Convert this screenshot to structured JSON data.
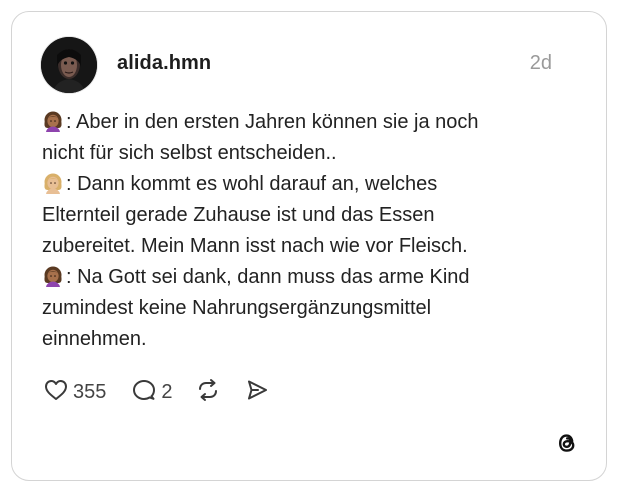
{
  "post": {
    "username": "alida.hmn",
    "timestamp": "2d",
    "lines": [
      {
        "speaker": "woman-brown",
        "text": ": Aber in den ersten Jahren können sie ja noch"
      },
      {
        "speaker": "",
        "text": "nicht für sich selbst entscheiden.."
      },
      {
        "speaker": "woman-blonde",
        "text": ": Dann kommt es wohl darauf an, welches"
      },
      {
        "speaker": "",
        "text": "Elternteil gerade Zuhause ist und das Essen"
      },
      {
        "speaker": "",
        "text": "zubereitet. Mein Mann isst nach wie vor Fleisch."
      },
      {
        "speaker": "woman-brown",
        "text": ": Na Gott sei dank, dann muss das arme Kind"
      },
      {
        "speaker": "",
        "text": "zumindest keine Nahrungsergänzungsmittel"
      },
      {
        "speaker": "",
        "text": "einnehmen."
      }
    ]
  },
  "actions": {
    "likes": "355",
    "replies": "2"
  },
  "icons": {
    "like": "heart-icon",
    "reply": "reply-bubble-icon",
    "repost": "repost-icon",
    "share": "send-icon",
    "brand": "threads-logo-icon"
  }
}
